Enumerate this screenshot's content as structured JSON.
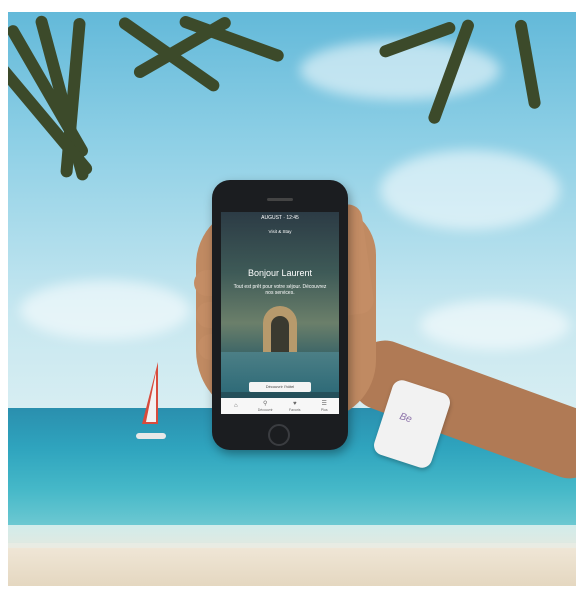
{
  "scene": {
    "description_colors": {
      "sky": "#8fd0e6",
      "sea": "#2fa4be",
      "sand": "#e9dfcc",
      "skin": "#c08a62",
      "phone": "#1b1d20",
      "wristband": "#f2f2f2",
      "sail": "#d84b3c"
    }
  },
  "phone_screen": {
    "status": "AUGUST · 12:45",
    "site": "Visit & Stay",
    "greeting": "Bonjour Laurent",
    "subtitle": "Tout est prêt pour votre séjour. Découvrez nos services.",
    "cta": "Découvrir l'hôtel",
    "tabs": [
      {
        "icon": "⌂",
        "label": ""
      },
      {
        "icon": "⚲",
        "label": "Découvrir"
      },
      {
        "icon": "♥",
        "label": "Favoris"
      },
      {
        "icon": "☰",
        "label": "Plus"
      }
    ]
  },
  "wristband": {
    "logo": "Be"
  }
}
